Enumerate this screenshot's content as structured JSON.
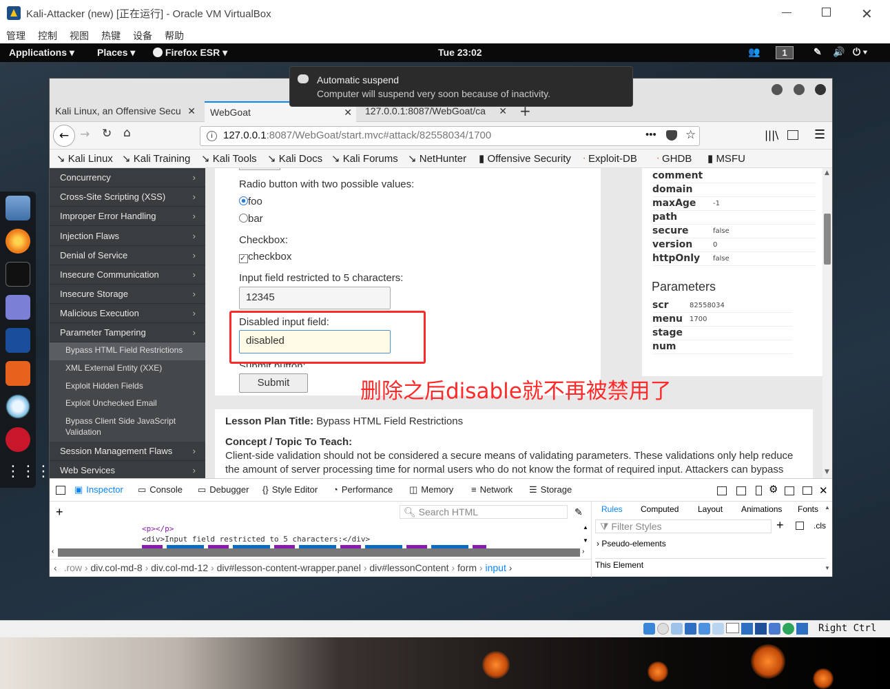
{
  "vbox": {
    "title": "Kali-Attacker (new) [正在运行] - Oracle VM VirtualBox",
    "menu": [
      "管理",
      "控制",
      "视图",
      "热键",
      "设备",
      "帮助"
    ],
    "host_key": "Right Ctrl"
  },
  "gnome": {
    "applications": "Applications",
    "places": "Places",
    "firefox": "Firefox ESR",
    "clock": "Tue 23:02",
    "workspace": "1"
  },
  "notification": {
    "title": "Automatic suspend",
    "body": "Computer will suspend very soon because of inactivity."
  },
  "firefox": {
    "tabs": [
      {
        "label": "Kali Linux, an Offensive Secu"
      },
      {
        "label": "WebGoat"
      },
      {
        "label": "127.0.0.1:8087/WebGoat/ca"
      }
    ],
    "url_host": "127.0.0.1",
    "url_rest": ":8087/WebGoat/start.mvc#attack/82558034/1700",
    "bookmarks": [
      "Kali Linux",
      "Kali Training",
      "Kali Tools",
      "Kali Docs",
      "Kali Forums",
      "NetHunter",
      "Offensive Security",
      "Exploit-DB",
      "GHDB",
      "MSFU"
    ]
  },
  "sidebar": {
    "items": [
      "Concurrency",
      "Cross-Site Scripting (XSS)",
      "Improper Error Handling",
      "Injection Flaws",
      "Denial of Service",
      "Insecure Communication",
      "Insecure Storage",
      "Malicious Execution",
      "Parameter Tampering"
    ],
    "sub_items": [
      "Bypass HTML Field Restrictions",
      "XML External Entity (XXE)",
      "Exploit Hidden Fields",
      "Exploit Unchecked Email",
      "Bypass Client Side JavaScript Validation"
    ],
    "bottom_items": [
      "Session Management Flaws",
      "Web Services"
    ]
  },
  "lesson": {
    "radio_label": "Radio button with two possible values:",
    "radio_foo": "foo",
    "radio_bar": "bar",
    "checkbox_label": "Checkbox:",
    "checkbox_text": "checkbox",
    "restricted_label": "Input field restricted to 5 characters:",
    "restricted_value": "12345",
    "disabled_label": "Disabled input field:",
    "disabled_value": "disabled",
    "submit_label": "Submit button:",
    "submit_button": "Submit",
    "annotation": "删除之后disable就不再被禁用了"
  },
  "cookie": {
    "rows": [
      {
        "k": "comment",
        "v": ""
      },
      {
        "k": "domain",
        "v": ""
      },
      {
        "k": "maxAge",
        "v": "-1"
      },
      {
        "k": "path",
        "v": ""
      },
      {
        "k": "secure",
        "v": "false"
      },
      {
        "k": "version",
        "v": "0"
      },
      {
        "k": "httpOnly",
        "v": "false"
      }
    ],
    "params_title": "Parameters",
    "params": [
      {
        "k": "scr",
        "v": "82558034"
      },
      {
        "k": "menu",
        "v": "1700"
      },
      {
        "k": "stage",
        "v": ""
      },
      {
        "k": "num",
        "v": ""
      }
    ]
  },
  "plan": {
    "title_label": "Lesson Plan Title:",
    "title_value": " Bypass HTML Field Restrictions",
    "concept_label": "Concept / Topic To Teach:",
    "concept_text": "Client-side validation should not be considered a secure means of validating parameters. These validations only help reduce the amount of server processing time for normal users who do not know the format of required input. Attackers can bypass these mechanisms easily in various ways. Any client-side validation should be duplicated on the server side."
  },
  "devtools": {
    "tabs": [
      "Inspector",
      "Console",
      "Debugger",
      "Style Editor",
      "Performance",
      "Memory",
      "Network",
      "Storage"
    ],
    "search_placeholder": "Search HTML",
    "code_line1": "<p></p>",
    "code_line2": "<div>Input field restricted to 5 characters:</div>",
    "breadcrumb": [
      ".row",
      "div.col-md-8",
      "div.col-md-12",
      "div#lesson-content-wrapper.panel",
      "div#lessonContent",
      "form",
      "input"
    ],
    "rules_tabs": [
      "Rules",
      "Computed",
      "Layout",
      "Animations",
      "Fonts"
    ],
    "filter_placeholder": "Filter Styles",
    "cls": ".cls",
    "pseudo": "Pseudo-elements",
    "this_element": "This Element"
  },
  "colors": {
    "accent_blue": "#0a84ff",
    "annotation_red": "#ff2a2a"
  }
}
